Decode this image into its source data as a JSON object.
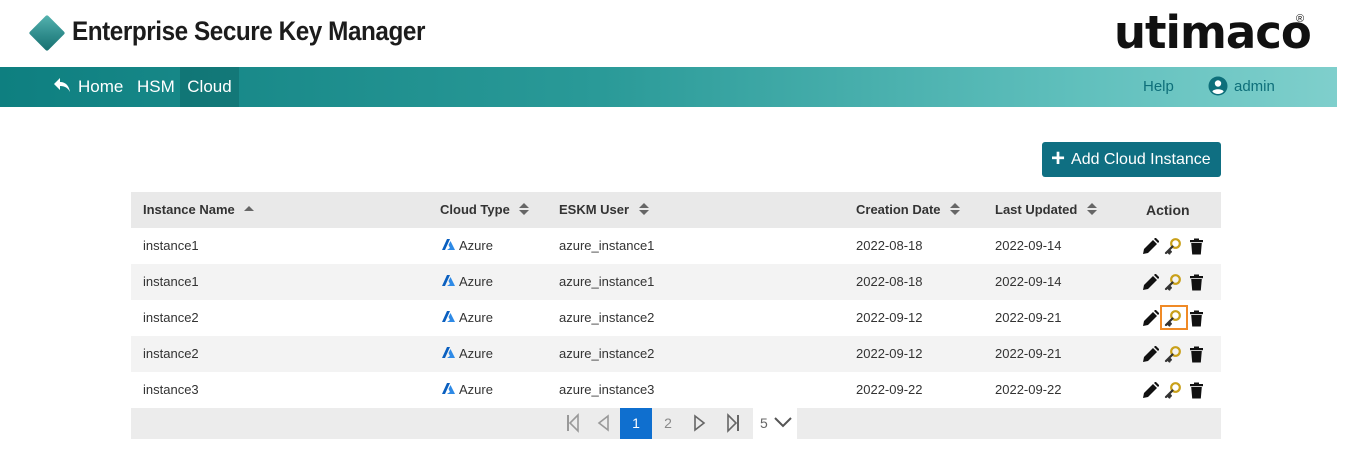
{
  "app": {
    "title": "Enterprise Secure Key Manager",
    "brand": "utimaco",
    "brand_mark": "®"
  },
  "nav": {
    "home": "Home",
    "hsm": "HSM",
    "cloud": "Cloud",
    "help": "Help",
    "user": "admin"
  },
  "actions": {
    "add_cloud_instance": "Add Cloud Instance"
  },
  "table": {
    "columns": [
      "Instance Name",
      "Cloud Type",
      "ESKM User",
      "Creation Date",
      "Last Updated",
      "Action"
    ],
    "sorted_column": "Instance Name",
    "rows": [
      {
        "instance_name": "instance1",
        "cloud_type": "Azure",
        "eskm_user": "azure_instance1",
        "creation_date": "2022-08-18",
        "last_updated": "2022-09-14"
      },
      {
        "instance_name": "instance1",
        "cloud_type": "Azure",
        "eskm_user": "azure_instance1",
        "creation_date": "2022-08-18",
        "last_updated": "2022-09-14"
      },
      {
        "instance_name": "instance2",
        "cloud_type": "Azure",
        "eskm_user": "azure_instance2",
        "creation_date": "2022-09-12",
        "last_updated": "2022-09-21"
      },
      {
        "instance_name": "instance2",
        "cloud_type": "Azure",
        "eskm_user": "azure_instance2",
        "creation_date": "2022-09-12",
        "last_updated": "2022-09-21"
      },
      {
        "instance_name": "instance3",
        "cloud_type": "Azure",
        "eskm_user": "azure_instance3",
        "creation_date": "2022-09-22",
        "last_updated": "2022-09-22"
      }
    ]
  },
  "pagination": {
    "pages": [
      "1",
      "2"
    ],
    "current_page": "1",
    "page_size": "5"
  },
  "colors": {
    "accent": "#0f6f82",
    "nav_start": "#0e7f80",
    "nav_end": "#7fcfcc",
    "highlight": "#f08a26",
    "current_page": "#0f6fcf"
  },
  "icons": {
    "logo": "diamond-logo-icon",
    "home": "back-arrow-icon",
    "user": "user-circle-icon",
    "add": "plus-icon",
    "sort": "sort-icon",
    "cloud_type": "azure-icon",
    "edit": "pencil-icon",
    "key": "key-icon",
    "delete": "trash-icon"
  }
}
